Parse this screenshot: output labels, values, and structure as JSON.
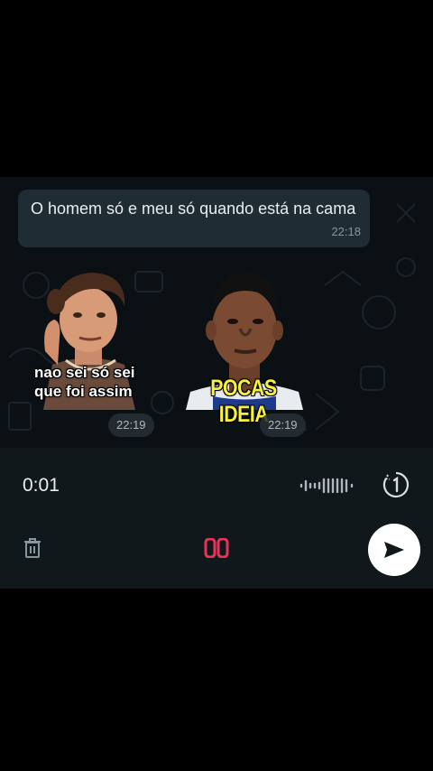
{
  "chat": {
    "message": {
      "text": "O homem só e meu só quando está na cama",
      "time": "22:18"
    },
    "stickers": [
      {
        "caption": "nao sei só sei que foi assim",
        "time": "22:19"
      },
      {
        "caption": "POCAS IDEIA",
        "time": "22:19"
      }
    ]
  },
  "recorder": {
    "elapsed": "0:01",
    "icons": {
      "waveform": "waveform-icon",
      "view_once": "view-once-icon",
      "delete": "trash-icon",
      "pause": "pause-icon",
      "send": "send-icon"
    },
    "colors": {
      "pause": "#e8345a",
      "send_bg": "#ffffff",
      "background": "#11181c"
    }
  },
  "colors": {
    "chat_background": "#0b1014",
    "bubble": "#1f2c33",
    "caption_yellow": "#f7f23c"
  }
}
